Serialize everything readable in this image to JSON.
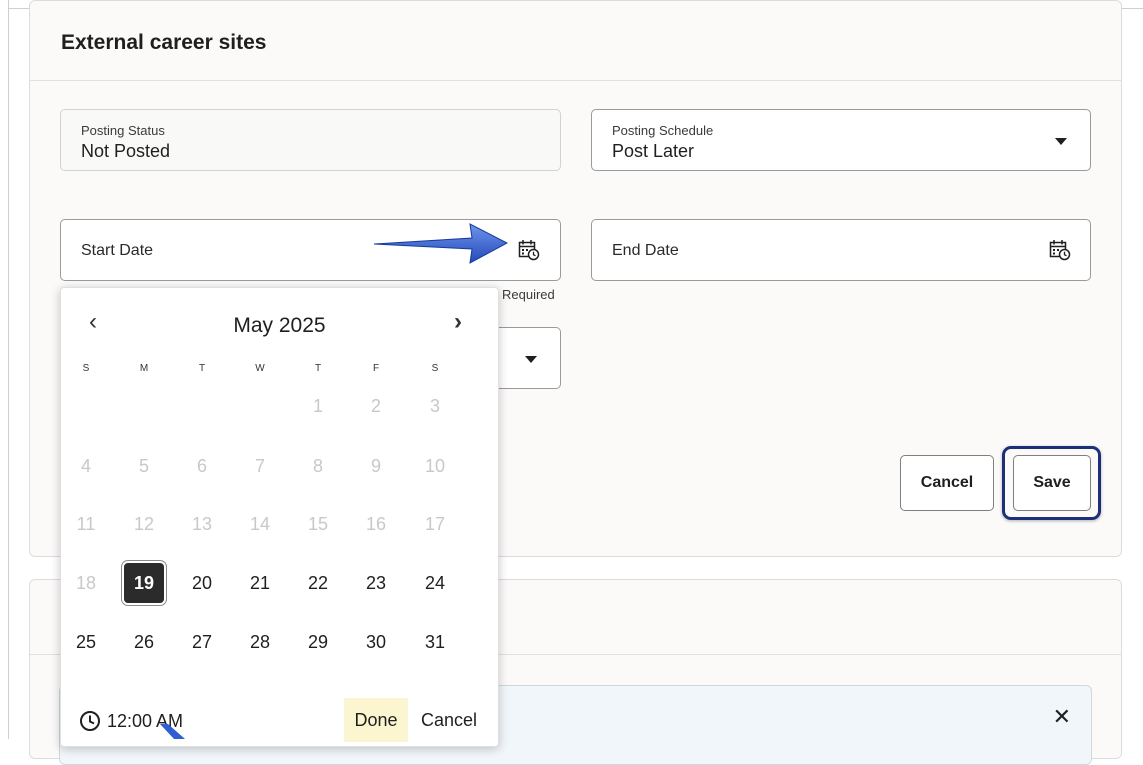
{
  "section": {
    "title": "External career sites"
  },
  "posting_status": {
    "label": "Posting Status",
    "value": "Not Posted"
  },
  "posting_schedule": {
    "label": "Posting Schedule",
    "value": "Post Later"
  },
  "start_date": {
    "label": "Start Date",
    "required_text": "Required"
  },
  "end_date": {
    "label": "End Date"
  },
  "actions": {
    "cancel_label": "Cancel",
    "save_label": "Save"
  },
  "banner": {
    "close_glyph": "✕"
  },
  "datepicker": {
    "month_label": "May 2025",
    "prev_glyph": "‹",
    "next_glyph": "›",
    "weekdays": [
      "S",
      "M",
      "T",
      "W",
      "T",
      "F",
      "S"
    ],
    "weeks": [
      [
        "",
        "",
        "",
        "",
        "1",
        "2",
        "3"
      ],
      [
        "4",
        "5",
        "6",
        "7",
        "8",
        "9",
        "10"
      ],
      [
        "11",
        "12",
        "13",
        "14",
        "15",
        "16",
        "17"
      ],
      [
        "18",
        "19",
        "20",
        "21",
        "22",
        "23",
        "24"
      ],
      [
        "25",
        "26",
        "27",
        "28",
        "29",
        "30",
        "31"
      ]
    ],
    "selected_day": "19",
    "time_value": "12:00 AM",
    "done_label": "Done",
    "cancel_label": "Cancel"
  },
  "colors": {
    "accent_ring": "#1c2f7a",
    "selected_day_bg": "#2b2b2b",
    "done_bg": "#fbf6cf",
    "arrow_blue": "#2f5fd0"
  }
}
